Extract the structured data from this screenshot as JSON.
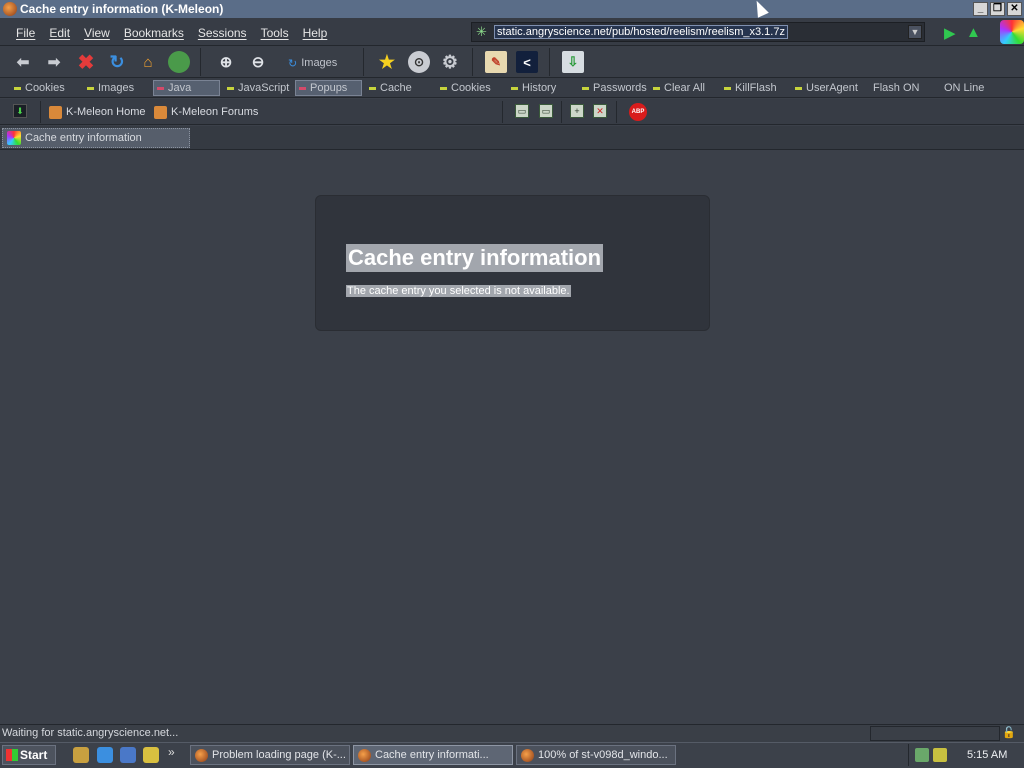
{
  "window": {
    "title": "Cache entry information (K-Meleon)",
    "minimize": "_",
    "restore": "❐",
    "close": "✕"
  },
  "menu": [
    "File",
    "Edit",
    "View",
    "Bookmarks",
    "Sessions",
    "Tools",
    "Help"
  ],
  "address": {
    "url": "static.angryscience.net/pub/hosted/reelism/reelism_x3.1.7z"
  },
  "toolbar": {
    "images_label": "Images"
  },
  "prefbar": [
    {
      "label": "Cookies",
      "pressed": false
    },
    {
      "label": "Images",
      "pressed": false
    },
    {
      "label": "Java",
      "pressed": true
    },
    {
      "label": "JavaScript",
      "pressed": false
    },
    {
      "label": "Popups",
      "pressed": true
    },
    {
      "label": "Cache",
      "pressed": false
    },
    {
      "label": "Cookies",
      "pressed": false
    },
    {
      "label": "History",
      "pressed": false
    },
    {
      "label": "Passwords",
      "pressed": false
    },
    {
      "label": "Clear All",
      "pressed": false
    },
    {
      "label": "KillFlash",
      "pressed": false
    },
    {
      "label": "UserAgent",
      "pressed": false
    },
    {
      "label": "Flash ON",
      "pressed": false
    },
    {
      "label": "ON Line",
      "pressed": false
    }
  ],
  "bookmarks": [
    "K-Meleon Home",
    "K-Meleon Forums"
  ],
  "tab": {
    "label": "Cache entry information"
  },
  "page": {
    "heading": "Cache entry information",
    "message": "The cache entry you selected is not available."
  },
  "status": {
    "text": "Waiting for static.angryscience.net..."
  },
  "taskbar": {
    "start": "Start",
    "tasks": [
      {
        "label": "Problem loading page (K-...",
        "active": false
      },
      {
        "label": "Cache entry informati...",
        "active": true
      },
      {
        "label": "100% of st-v098d_windo...",
        "active": false
      }
    ],
    "clock": "5:15 AM"
  }
}
